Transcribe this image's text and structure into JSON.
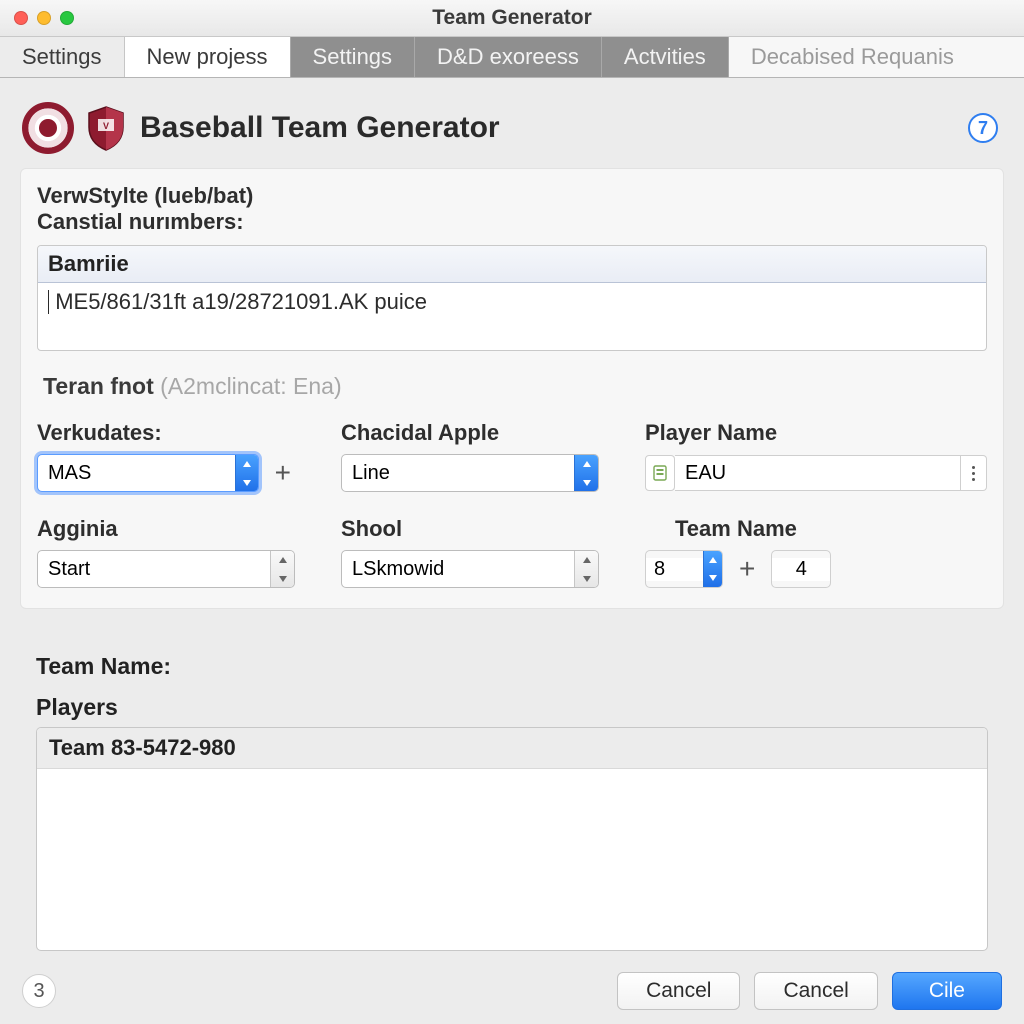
{
  "window": {
    "title": "Team Generator"
  },
  "tabs": {
    "side": "Settings",
    "items": [
      "New projess",
      "Settings",
      "D&D exoreess",
      "Actvities",
      "Decabised Requanis"
    ],
    "active_index": 0
  },
  "header": {
    "title": "Baseball Team Generator",
    "help_badge": "7"
  },
  "upper": {
    "line1": "VerwStylte (lueb/bat)",
    "line2": "Canstial nurımbers:",
    "col_header": "Bamriie",
    "body_text": "ME5/861/31ft a19/28721091.AK puice"
  },
  "section2": {
    "title": "Teran fnot",
    "hint": "(A2mclincat: Ena)"
  },
  "fields": {
    "f1": {
      "label": "Verkudates:",
      "value": "MAS"
    },
    "f2": {
      "label": "Chacidal Apple",
      "value": "Line"
    },
    "f3": {
      "label": "Player Name",
      "value": "EAU"
    },
    "f4": {
      "label": "Agginia",
      "value": "Start"
    },
    "f5": {
      "label": "Shool",
      "value": "LSkmowid"
    },
    "f6": {
      "label": "Team Name",
      "value1": "8",
      "value2": "4"
    }
  },
  "team": {
    "label": "Team Name:",
    "players_label": "Players",
    "row": "Team 83-5472-980"
  },
  "footer": {
    "step": "3",
    "cancel1": "Cancel",
    "cancel2": "Cancel",
    "primary": "Cile"
  },
  "plus": "+"
}
